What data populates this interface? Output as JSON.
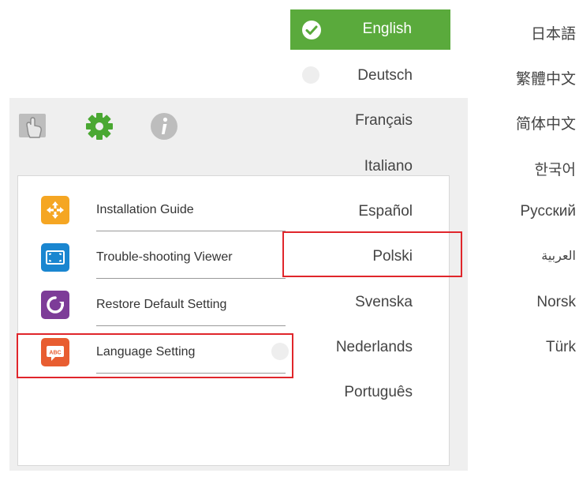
{
  "menu": {
    "items": [
      {
        "label": "Installation Guide",
        "color": "#f5a623"
      },
      {
        "label": "Trouble-shooting Viewer",
        "color": "#1a86d0"
      },
      {
        "label": "Restore Default Setting",
        "color": "#7d3c98"
      },
      {
        "label": "Language Setting",
        "color": "#e85d31",
        "badge": "ABC"
      }
    ]
  },
  "toolbar": {
    "icons": [
      "touch-hand-icon",
      "gear-icon",
      "info-icon"
    ],
    "accent": "#4aa832"
  },
  "languages": {
    "selected": "English",
    "left_column": [
      "Deutsch",
      "Français",
      "Italiano",
      "Español",
      "Polski",
      "Svenska",
      "Nederlands",
      "Português"
    ],
    "right_column": [
      "日本語",
      "繁體中文",
      "简体中文",
      "한국어",
      "Русский",
      "العربية",
      "Norsk",
      "Türk"
    ],
    "highlight_color": "#5aaa3c"
  }
}
